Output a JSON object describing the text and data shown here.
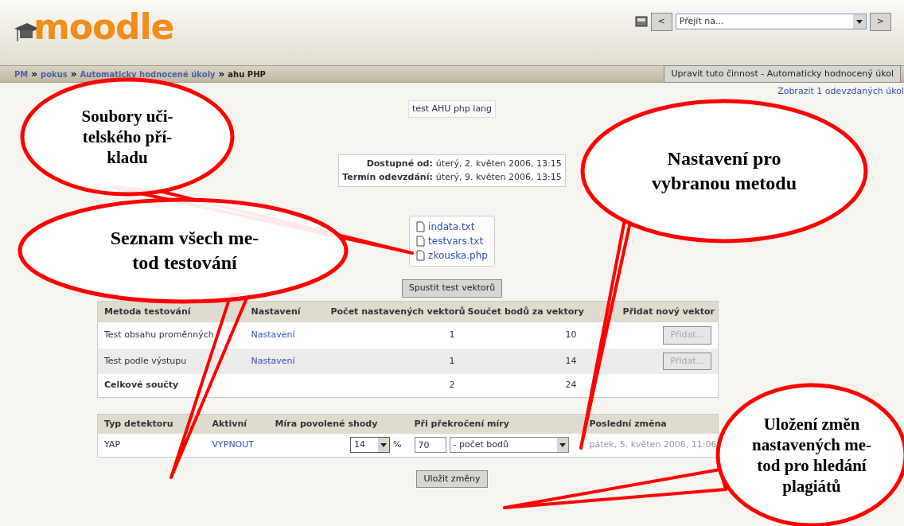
{
  "header": {
    "logo": "moodle",
    "jump_select": "Přejít na...",
    "prev": "<",
    "next": ">"
  },
  "breadcrumb": {
    "separator": "»",
    "items": [
      "PM",
      "pokus",
      "Automaticky hodnocené úkoly",
      "ahu PHP"
    ]
  },
  "edit_button": "Upravit tuto činnost - Automaticky hodnocený úkol",
  "submissions_link": "Zobrazit 1 odevzdaných úkol",
  "description": "test AHU php lang",
  "dates": [
    {
      "label": "Dostupné od:",
      "value": "úterý, 2. květen 2006, 13:15"
    },
    {
      "label": "Termín odevzdání:",
      "value": "úterý, 9. květen 2006, 13:15"
    }
  ],
  "files": [
    "indata.txt",
    "testvars.txt",
    "zkouska.php"
  ],
  "run_button": "Spustit test vektorů",
  "methods_table": {
    "columns": [
      "Metoda testování",
      "Nastavení",
      "Počet nastavených vektorů",
      "Součet bodů za vektory",
      "Přidat nový vektor"
    ],
    "rows": [
      {
        "method": "Test obsahu proměnných",
        "settings": "Nastavení",
        "vectors": "1",
        "points": "10",
        "add_button": "Přidat...",
        "disabled": true
      },
      {
        "method": "Test podle výstupu",
        "settings": "Nastavení",
        "vectors": "1",
        "points": "14",
        "add_button": "Přidat...",
        "disabled": true
      }
    ],
    "totals": {
      "label": "Celkové součty",
      "vectors": "2",
      "points": "24"
    }
  },
  "detectors_table": {
    "columns": [
      "Typ detektoru",
      "Aktivní",
      "Míra povolené shody",
      "Při překročení míry",
      "Poslední změna"
    ],
    "rows": [
      {
        "type": "YAP",
        "toggle": "VYPNOUT",
        "threshold": "14",
        "unit": "%",
        "points": "70",
        "action": "- počet bodů",
        "last_change": "pátek, 5. květen 2006, 11:06"
      }
    ]
  },
  "save_button": "Uložit změny",
  "callouts": [
    {
      "lines": [
        "Soubory uči-",
        "telského pří-",
        "kladu"
      ]
    },
    {
      "lines": [
        "Seznam všech me-",
        "tod testování"
      ]
    },
    {
      "lines": [
        "Nastavení pro",
        "vybranou metodu"
      ]
    },
    {
      "lines": [
        "Uložení změn",
        "nastavených me-",
        "tod pro hledání",
        "plagiátů"
      ]
    }
  ]
}
